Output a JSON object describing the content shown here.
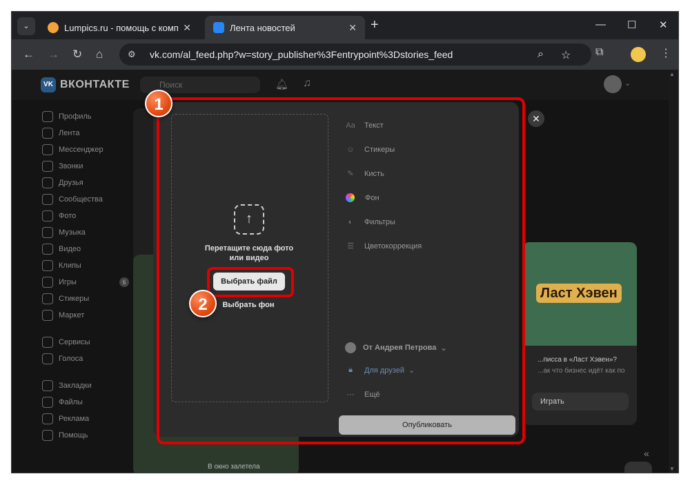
{
  "browser": {
    "tabs": [
      {
        "title": "Lumpics.ru - помощь с компь",
        "favicon": "lumpics-favicon",
        "color": "#f3a33a"
      },
      {
        "title": "Лента новостей",
        "favicon": "vk-favicon",
        "color": "#2787f5"
      }
    ],
    "url": "vk.com/al_feed.php?w=story_publisher%3Fentrypoint%3Dstories_feed"
  },
  "vk": {
    "logo_text": "ВКОНТАКТЕ",
    "search_placeholder": "Поиск",
    "sidebar": [
      {
        "label": "Профиль",
        "icon": "user-icon"
      },
      {
        "label": "Лента",
        "icon": "feed-icon"
      },
      {
        "label": "Мессенджер",
        "icon": "chat-icon"
      },
      {
        "label": "Звонки",
        "icon": "phone-icon"
      },
      {
        "label": "Друзья",
        "icon": "friends-icon"
      },
      {
        "label": "Сообщества",
        "icon": "groups-icon"
      },
      {
        "label": "Фото",
        "icon": "photo-icon"
      },
      {
        "label": "Музыка",
        "icon": "music-icon"
      },
      {
        "label": "Видео",
        "icon": "video-icon"
      },
      {
        "label": "Клипы",
        "icon": "clips-icon"
      },
      {
        "label": "Игры",
        "icon": "games-icon",
        "badge": "6"
      },
      {
        "label": "Стикеры",
        "icon": "sticker-icon"
      },
      {
        "label": "Маркет",
        "icon": "market-icon"
      }
    ],
    "sidebar2": [
      {
        "label": "Сервисы",
        "icon": "services-icon"
      },
      {
        "label": "Голоса",
        "icon": "voices-icon"
      }
    ],
    "sidebar3": [
      {
        "label": "Закладки",
        "icon": "bookmark-icon"
      },
      {
        "label": "Файлы",
        "icon": "files-icon"
      },
      {
        "label": "Реклама",
        "icon": "ads-icon"
      },
      {
        "label": "Помощь",
        "icon": "help-icon"
      }
    ],
    "feed_snippet": "В окно залетела",
    "ad_card": {
      "art_title": "Ласт Хэвен",
      "question": "...писса в «Ласт Хэвен»?",
      "subtitle": "...ак что бизнес идёт как по",
      "play_label": "Играть"
    }
  },
  "story_editor": {
    "drop_text": "Перетащите сюда фото или видео",
    "choose_file": "Выбрать файл",
    "choose_background": "Выбрать фон",
    "tools": [
      {
        "label": "Текст",
        "icon": "text-icon",
        "glyph": "Aa"
      },
      {
        "label": "Стикеры",
        "icon": "sticker-icon",
        "glyph": "☺"
      },
      {
        "label": "Кисть",
        "icon": "brush-icon",
        "glyph": "✎"
      },
      {
        "label": "Фон",
        "icon": "palette-icon",
        "glyph": ""
      },
      {
        "label": "Фильтры",
        "icon": "filters-icon",
        "glyph": "◐"
      },
      {
        "label": "Цветокоррекция",
        "icon": "adjust-icon",
        "glyph": "☰"
      }
    ],
    "author": "От Андрея Петрова",
    "privacy": "Для друзей",
    "more": "Ещё",
    "publish": "Опубликовать"
  },
  "annotations": {
    "marker1": "1",
    "marker2": "2",
    "color": "#e00000"
  }
}
